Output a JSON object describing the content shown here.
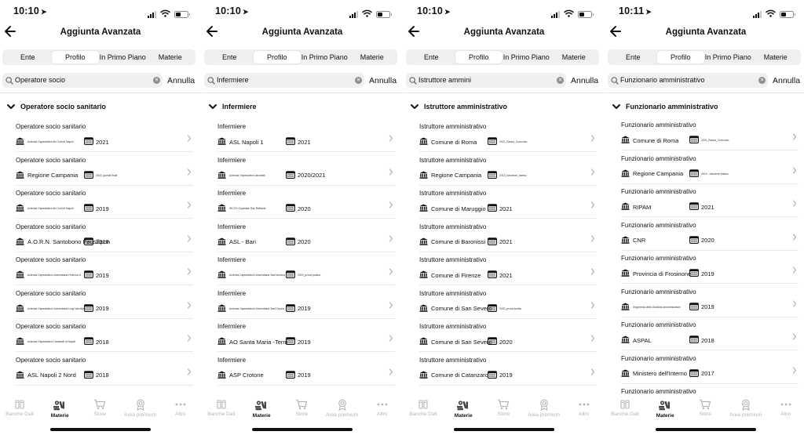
{
  "header_title": "Aggiunta Avanzata",
  "tabs": [
    "Ente",
    "Profilo",
    "In Primo Piano",
    "Materie"
  ],
  "active_tab": 1,
  "cancel_label": "Annulla",
  "bottom_tabs": [
    {
      "label": "Banche Dati",
      "icon": "book-icon"
    },
    {
      "label": "Materie",
      "icon": "books-icon"
    },
    {
      "label": "Store",
      "icon": "cart-icon"
    },
    {
      "label": "Area premium",
      "icon": "medal-icon"
    },
    {
      "label": "Altro",
      "icon": "more-icon"
    }
  ],
  "active_bottom_tab": 1,
  "screens": [
    {
      "time": "10:10",
      "search_value": "Operatore socio",
      "group_title": "Operatore socio sanitario",
      "items": [
        {
          "title": "Operatore socio sanitario",
          "ente": "Azienda Ospedaliera dei Colli di Napoli",
          "ente_small": true,
          "year": "2021",
          "year_small": false
        },
        {
          "title": "Operatore socio sanitario",
          "ente": "Regione Campania",
          "ente_small": false,
          "year": "2019_quesiti finali",
          "year_small": true
        },
        {
          "title": "Operatore socio sanitario",
          "ente": "Azienda Ospedaliera dei Colli di Napoli",
          "ente_small": true,
          "year": "2019",
          "year_small": false
        },
        {
          "title": "Operatore socio sanitario",
          "ente": "A.O.R.N. Santobono Pausilipon",
          "ente_small": false,
          "year": "2019",
          "year_small": false
        },
        {
          "title": "Operatore socio sanitario",
          "ente": "Azienda Ospedaliera Universitaria Federico II",
          "ente_small": true,
          "year": "2019",
          "year_small": false
        },
        {
          "title": "Operatore socio sanitario",
          "ente": "Azienda Ospedaliera Universitaria Luigi Vanvitelli",
          "ente_small": true,
          "year": "2019",
          "year_small": false
        },
        {
          "title": "Operatore socio sanitario",
          "ente": "Azienda Ospedaliera Cardarelli di Napoli",
          "ente_small": true,
          "year": "2018",
          "year_small": false
        },
        {
          "title": "Operatore socio sanitario",
          "ente": "ASL Napoli 2 Nord",
          "ente_small": false,
          "year": "2018",
          "year_small": false
        }
      ]
    },
    {
      "time": "10:10",
      "search_value": "Infermiere",
      "group_title": "Infermiere",
      "items": [
        {
          "title": "Infermiere",
          "ente": "ASL Napoli 1",
          "ente_small": false,
          "year": "2021",
          "year_small": false
        },
        {
          "title": "Infermiere",
          "ente": "Azienda Ospedaliera Vanvitelli",
          "ente_small": true,
          "year": "2020/2021",
          "year_small": false
        },
        {
          "title": "Infermiere",
          "ente": "IRCCS Ospedale San Raffaele",
          "ente_small": true,
          "year": "2020",
          "year_small": false
        },
        {
          "title": "Infermiere",
          "ente": "ASL - Bari",
          "ente_small": false,
          "year": "2020",
          "year_small": false
        },
        {
          "title": "Infermiere",
          "ente": "Azienda Ospedaliera Universitaria Sant'Andrea",
          "ente_small": true,
          "year": "2019_prova pratica",
          "year_small": true
        },
        {
          "title": "Infermiere",
          "ente": "Azienda Ospedaliera Universitaria Sant'Orsola",
          "ente_small": true,
          "year": "2019",
          "year_small": false
        },
        {
          "title": "Infermiere",
          "ente": "AO Santa Maria -Terni",
          "ente_small": false,
          "year": "2019",
          "year_small": false
        },
        {
          "title": "Infermiere",
          "ente": "ASP Crotone",
          "ente_small": false,
          "year": "2019",
          "year_small": false
        }
      ]
    },
    {
      "time": "10:10",
      "search_value": "Istruttore ammini",
      "group_title": "Istruttore amministrativo",
      "items": [
        {
          "title": "Istruttore amministrativo",
          "ente": "Comune di Roma",
          "ente_small": false,
          "year": "2021_Banca_Concorso",
          "year_small": true
        },
        {
          "title": "Istruttore amministrativo",
          "ente": "Regione Campania",
          "ente_small": false,
          "year": "2019_Istruttore_esteso",
          "year_small": true
        },
        {
          "title": "Istruttore amministrativo",
          "ente": "Comune di Maruggio",
          "ente_small": false,
          "year": "2021",
          "year_small": false
        },
        {
          "title": "Istruttore amministrativo",
          "ente": "Comune di Baronissi",
          "ente_small": false,
          "year": "2021",
          "year_small": false
        },
        {
          "title": "Istruttore amministrativo",
          "ente": "Comune di Firenze",
          "ente_small": false,
          "year": "2021",
          "year_small": false
        },
        {
          "title": "Istruttore amministrativo",
          "ente": "Comune di San Severo",
          "ente_small": false,
          "year": "2020_prova scritta",
          "year_small": true
        },
        {
          "title": "Istruttore amministrativo",
          "ente": "Comune di San Severo",
          "ente_small": false,
          "year": "2020",
          "year_small": false
        },
        {
          "title": "Istruttore amministrativo",
          "ente": "Comune di Catanzaro",
          "ente_small": false,
          "year": "2019",
          "year_small": false
        }
      ]
    },
    {
      "time": "10:11",
      "search_value": "Funzionario amministrativo",
      "group_title": "Funzionario amministrativo",
      "items": [
        {
          "title": "Funzionario amministrativo",
          "ente": "Comune di Roma",
          "ente_small": false,
          "year": "2021_Banca_Concorso",
          "year_small": true
        },
        {
          "title": "Funzionario amministrativo",
          "ente": "Regione Campania",
          "ente_small": false,
          "year": "2019 - Istruttore esteso",
          "year_small": true
        },
        {
          "title": "Funzionario amministrativo",
          "ente": "RIPAM",
          "ente_small": false,
          "year": "2021",
          "year_small": false
        },
        {
          "title": "Funzionario amministrativo",
          "ente": "CNR",
          "ente_small": false,
          "year": "2020",
          "year_small": false
        },
        {
          "title": "Funzionario amministrativo",
          "ente": "Provincia di Frosinone",
          "ente_small": false,
          "year": "2019",
          "year_small": false
        },
        {
          "title": "Funzionario amministrativo",
          "ente": "Segreteria della Giustizia amministrativa",
          "ente_small": true,
          "year": "2019",
          "year_small": false
        },
        {
          "title": "Funzionario amministrativo",
          "ente": "ASPAL",
          "ente_small": false,
          "year": "2018",
          "year_small": false
        },
        {
          "title": "Funzionario amministrativo",
          "ente": "Ministero dell'Interno",
          "ente_small": false,
          "year": "2017",
          "year_small": false
        },
        {
          "title": "Funzionario amministrativo",
          "ente": "",
          "ente_small": false,
          "year": "",
          "year_small": false
        }
      ]
    }
  ]
}
